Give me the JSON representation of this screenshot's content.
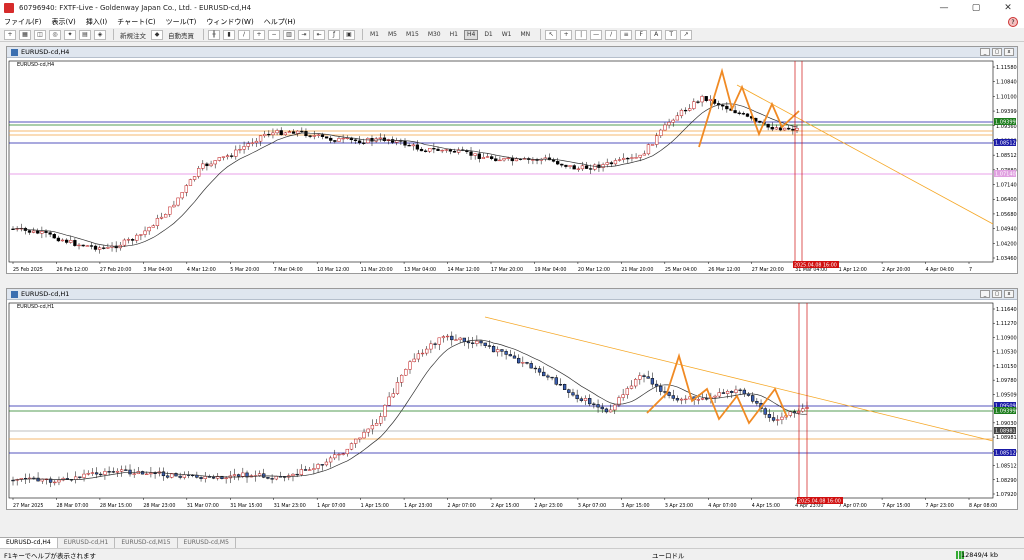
{
  "window": {
    "title": "60796940: FXTF-Live - Goldenway Japan Co., Ltd. - EURUSD-cd,H4",
    "controls": [
      "—",
      "▢",
      "✕"
    ]
  },
  "menu": [
    "ファイル(F)",
    "表示(V)",
    "挿入(I)",
    "チャート(C)",
    "ツール(T)",
    "ウィンドウ(W)",
    "ヘルプ(H)"
  ],
  "toolbar": {
    "new_order": "新規注文",
    "auto_trade": "自動売買",
    "timeframes": [
      "M1",
      "M5",
      "M15",
      "M30",
      "H1",
      "H4",
      "D1",
      "W1",
      "MN"
    ],
    "active_timeframe": "H4"
  },
  "charts": [
    {
      "window_title": "EURUSD-cd,H4",
      "symbol_label": "EURUSD-cd,H4",
      "price_labels": [
        "1.11580",
        "1.10840",
        "1.10100",
        "1.09399",
        "1.09360",
        "1.08900",
        "1.08512",
        "1.07880",
        "1.07140",
        "1.06400",
        "1.05680",
        "1.04940",
        "1.04200",
        "1.03460"
      ],
      "tagged_prices": [
        {
          "value": "1.09399",
          "color": "#1e7d1e"
        },
        {
          "value": "1.08512",
          "color": "#1a1aa6"
        },
        {
          "value": "1.07140",
          "color": "#e0a0e0"
        }
      ],
      "time_labels": [
        "25 Feb 2025",
        "26 Feb 12:00",
        "27 Feb 20:00",
        "3 Mar 04:00",
        "4 Mar 12:00",
        "5 Mar 20:00",
        "7 Mar 04:00",
        "10 Mar 12:00",
        "11 Mar 20:00",
        "13 Mar 04:00",
        "14 Mar 12:00",
        "17 Mar 20:00",
        "19 Mar 04:00",
        "20 Mar 12:00",
        "21 Mar 20:00",
        "25 Mar 04:00",
        "26 Mar 12:00",
        "27 Mar 20:00",
        "31 Mar 04:00",
        "1 Apr 12:00",
        "2 Apr 20:00",
        "4 Apr 04:00",
        "7"
      ],
      "time_tag": "2025.04.08 16:00"
    },
    {
      "window_title": "EURUSD-cd,H1",
      "symbol_label": "EURUSD-cd,H1",
      "price_labels": [
        "1.11640",
        "1.11270",
        "1.10900",
        "1.10530",
        "1.10150",
        "1.09780",
        "1.09509",
        "1.09399",
        "1.09030",
        "1.08981",
        "1.08660",
        "1.08512",
        "1.08290",
        "1.07920"
      ],
      "tagged_prices": [
        {
          "value": "1.09509",
          "color": "#1a1aa6"
        },
        {
          "value": "1.09399",
          "color": "#1e7d1e"
        },
        {
          "value": "1.08981",
          "color": "#444444"
        },
        {
          "value": "1.08512",
          "color": "#1a1aa6"
        }
      ],
      "time_labels": [
        "27 Mar 2025",
        "28 Mar 07:00",
        "28 Mar 15:00",
        "28 Mar 23:00",
        "31 Mar 07:00",
        "31 Mar 15:00",
        "31 Mar 23:00",
        "1 Apr 07:00",
        "1 Apr 15:00",
        "1 Apr 23:00",
        "2 Apr 07:00",
        "2 Apr 15:00",
        "2 Apr 23:00",
        "3 Apr 07:00",
        "3 Apr 15:00",
        "3 Apr 23:00",
        "4 Apr 07:00",
        "4 Apr 15:00",
        "4 Apr 23:00",
        "7 Apr 07:00",
        "7 Apr 15:00",
        "7 Apr 23:00",
        "8 Apr 08:00"
      ],
      "time_tag": "2025.04.08 16:00"
    }
  ],
  "tabs": [
    "EURUSD-cd,H4",
    "EURUSD-cd,H1",
    "EURUSD-cd,M15",
    "EURUSD-cd,M5"
  ],
  "active_tab": "EURUSD-cd,H4",
  "status": {
    "help_text": "F1キーでヘルプが表示されます",
    "profile": "ユーロドル",
    "traffic": "12849/4 kb"
  }
}
